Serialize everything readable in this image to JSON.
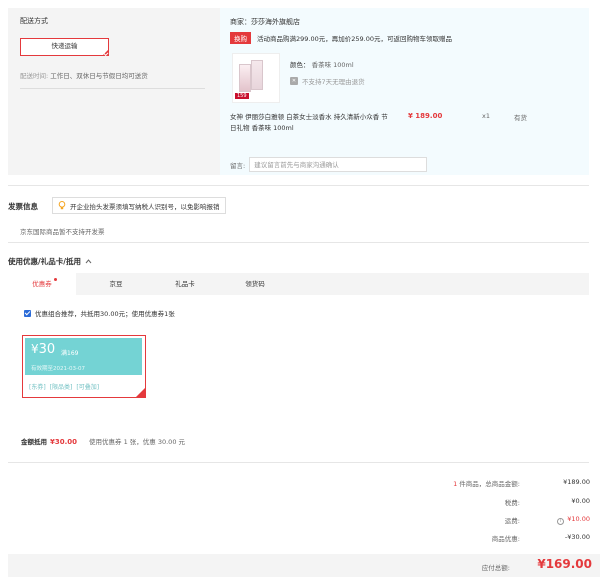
{
  "delivery": {
    "title": "配送方式",
    "option_label": "快递运输",
    "time_label": "配送时间:",
    "time_value": "工作日、双休日与节假日均可送货"
  },
  "shop": {
    "name": "商家：莎莎海外旗舰店",
    "promo_tag": "换购",
    "promo_text": "活动商品购满299.00元，再加价259.00元，可返回购物车领取赠品",
    "product": {
      "image_badge": "159",
      "color_label": "颜色：",
      "color_value": "香茶味 100ml",
      "no_return_icon": "no-return-icon",
      "no_return_text": "不支持7天无理由退货",
      "name": "女神 伊丽莎白雅顿 白茶女士淡香水 持久清新小众香 节日礼物 香茶味 100ml",
      "price": "¥ 189.00",
      "qty": "x1",
      "stock": "有货"
    },
    "message_label": "留言:",
    "message_placeholder": "建议留言前先与商家沟通确认"
  },
  "invoice": {
    "title": "发票信息",
    "tip": "开企业抬头发票须填写纳税人识别号，以免影响报销",
    "note": "京东国际商品暂不支持开发票"
  },
  "coupons": {
    "title": "使用优惠/礼品卡/抵用",
    "tabs": [
      {
        "label": "优惠券",
        "active": true
      },
      {
        "label": "京豆",
        "active": false
      },
      {
        "label": "礼品卡",
        "active": false
      },
      {
        "label": "领货码",
        "active": false
      }
    ],
    "combo_text": "优惠组合推荐，共抵用30.00元；使用优惠券1张",
    "coupon": {
      "currency": "¥",
      "amount": "30",
      "condition": "满169",
      "expire": "有效期至2021-03-07",
      "tags": [
        "[东券]",
        "[限品类]",
        "[可叠加]"
      ]
    },
    "summary_label": "金额抵用",
    "summary_amount": "¥30.00",
    "summary_desc": "使用优惠券 1 张，优惠 30.00 元"
  },
  "summary": {
    "count": "1",
    "count_suffix": "件商品，总商品金额:",
    "total": "¥189.00",
    "tax_label": "税费:",
    "tax": "¥0.00",
    "freight_label": "运费:",
    "freight": "¥10.00",
    "discount_label": "商品优惠:",
    "discount": "-¥30.00",
    "pay_label": "应付总额:",
    "pay_total": "¥169.00"
  }
}
